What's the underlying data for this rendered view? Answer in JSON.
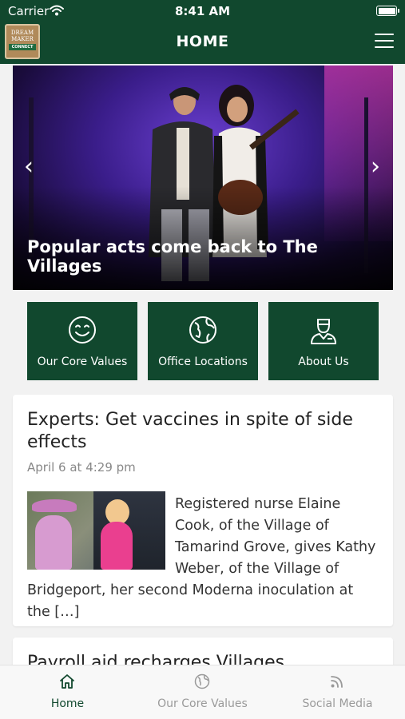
{
  "status_bar": {
    "carrier": "Carrier",
    "time": "8:41 AM"
  },
  "header": {
    "logo_lines": [
      "DREAM",
      "MAKER",
      "CONNECT"
    ],
    "title": "HOME",
    "menu_icon": "hamburger-menu-icon"
  },
  "hero": {
    "caption": "Popular acts come back to The Villages",
    "prev_icon": "chevron-left-icon",
    "next_icon": "chevron-right-icon"
  },
  "quick_links": [
    {
      "label": "Our Core Values",
      "icon": "smiley-icon"
    },
    {
      "label": "Office Locations",
      "icon": "globe-icon"
    },
    {
      "label": "About Us",
      "icon": "user-badge-icon"
    }
  ],
  "articles": [
    {
      "title": "Experts: Get vaccines in spite of side effects",
      "date": "April 6 at 4:29 pm",
      "excerpt": "Registered nurse Elaine Cook, of the Village of Tamarind Grove, gives Kathy Weber, of the Village of Bridgeport, her second Moderna inoculation at the […]"
    },
    {
      "title": "Payroll aid recharges Villages"
    }
  ],
  "tabbar": {
    "tabs": [
      {
        "label": "Home",
        "icon": "home-icon",
        "active": true
      },
      {
        "label": "Our Core Values",
        "icon": "globe-icon",
        "active": false
      },
      {
        "label": "Social Media",
        "icon": "rss-icon",
        "active": false
      }
    ]
  },
  "colors": {
    "brand_green": "#11482e",
    "tab_inactive": "#9a9a9a",
    "background": "#f2f2f2"
  }
}
